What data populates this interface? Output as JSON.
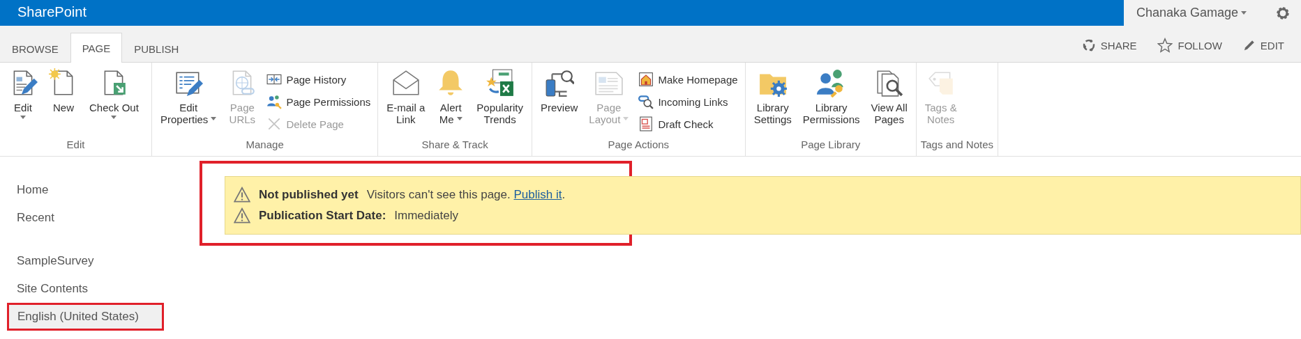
{
  "suite_bar": {
    "brand": "SharePoint",
    "user": "Chanaka Gamage"
  },
  "tabs": [
    {
      "label": "BROWSE",
      "selected": false
    },
    {
      "label": "PAGE",
      "selected": true
    },
    {
      "label": "PUBLISH",
      "selected": false
    }
  ],
  "page_actions": [
    {
      "label": "SHARE"
    },
    {
      "label": "FOLLOW"
    },
    {
      "label": "EDIT"
    }
  ],
  "ribbon": {
    "groups": [
      {
        "label": "Edit",
        "items": [
          {
            "kind": "large",
            "label": "Edit",
            "disabled": false,
            "dropdown": true
          },
          {
            "kind": "large",
            "label": "New",
            "disabled": false
          },
          {
            "kind": "large",
            "label": "Check Out",
            "disabled": false,
            "dropdown": true
          }
        ]
      },
      {
        "label": "Manage",
        "items": [
          {
            "kind": "large",
            "label": "Edit\nProperties",
            "disabled": false,
            "dropdown": true
          },
          {
            "kind": "large",
            "label": "Page\nURLs",
            "disabled": true
          },
          {
            "kind": "small",
            "label": "Page History",
            "disabled": false
          },
          {
            "kind": "small",
            "label": "Page Permissions",
            "disabled": false
          },
          {
            "kind": "small",
            "label": "Delete Page",
            "disabled": true
          }
        ]
      },
      {
        "label": "Share & Track",
        "items": [
          {
            "kind": "large",
            "label": "E-mail a\nLink",
            "disabled": false
          },
          {
            "kind": "large",
            "label": "Alert\nMe",
            "disabled": false,
            "dropdown": true
          },
          {
            "kind": "large",
            "label": "Popularity\nTrends",
            "disabled": false
          }
        ]
      },
      {
        "label": "Page Actions",
        "items": [
          {
            "kind": "large",
            "label": "Preview",
            "disabled": false
          },
          {
            "kind": "large",
            "label": "Page\nLayout",
            "disabled": true,
            "dropdown": true
          },
          {
            "kind": "small",
            "label": "Make Homepage",
            "disabled": false
          },
          {
            "kind": "small",
            "label": "Incoming Links",
            "disabled": false
          },
          {
            "kind": "small",
            "label": "Draft Check",
            "disabled": false
          }
        ]
      },
      {
        "label": "Page Library",
        "items": [
          {
            "kind": "large",
            "label": "Library\nSettings",
            "disabled": false
          },
          {
            "kind": "large",
            "label": "Library\nPermissions",
            "disabled": false
          },
          {
            "kind": "large",
            "label": "View All\nPages",
            "disabled": false
          }
        ]
      },
      {
        "label": "Tags and Notes",
        "items": [
          {
            "kind": "large",
            "label": "Tags &\nNotes",
            "disabled": true
          }
        ]
      }
    ]
  },
  "nav": {
    "sections": [
      [
        {
          "label": "Home",
          "selected": false,
          "highlighted": false
        },
        {
          "label": "Recent",
          "selected": false,
          "highlighted": false
        }
      ],
      [
        {
          "label": "SampleSurvey",
          "selected": false,
          "highlighted": false
        },
        {
          "label": "Site Contents",
          "selected": false,
          "highlighted": false
        },
        {
          "label": "English (United States)",
          "selected": true,
          "highlighted": true
        }
      ]
    ]
  },
  "status_banner": {
    "highlighted": true,
    "lines": [
      {
        "title": "Not published yet",
        "text": "Visitors can't see this page.",
        "link": "Publish it",
        "after": "."
      },
      {
        "title": "Publication Start Date:",
        "text": "Immediately"
      }
    ]
  }
}
